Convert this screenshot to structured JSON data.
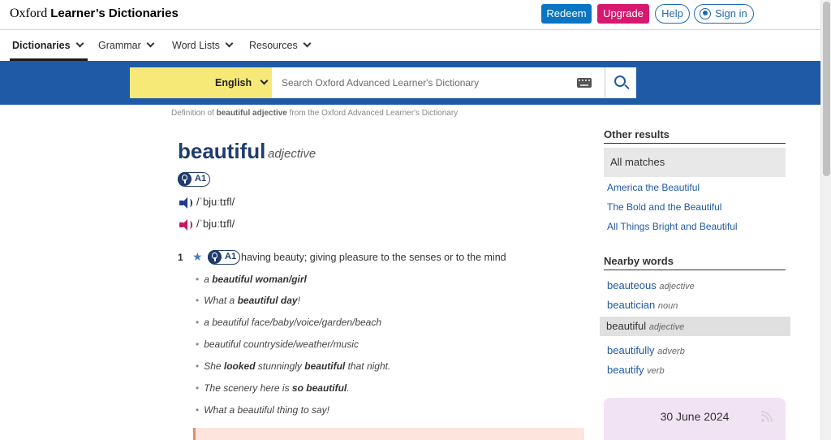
{
  "header": {
    "logo_part1": "Oxford ",
    "logo_part2": "Learner’s Dictionaries",
    "redeem": "Redeem",
    "upgrade": "Upgrade",
    "help": "Help",
    "sign_in": "Sign in"
  },
  "nav": {
    "items": [
      {
        "label": "Dictionaries"
      },
      {
        "label": "Grammar"
      },
      {
        "label": "Word Lists"
      },
      {
        "label": "Resources"
      }
    ]
  },
  "search": {
    "language": "English",
    "placeholder": "Search Oxford Advanced Learner's Dictionary"
  },
  "definition_line": {
    "prefix": "Definition of ",
    "term": "beautiful adjective",
    "suffix": " from the Oxford Advanced Learner's Dictionary"
  },
  "entry": {
    "headword": "beautiful",
    "pos": "adjective",
    "level": "A1",
    "pron_br": "/ˈbjuːtɪfl/",
    "pron_us": "/ˈbjuːtɪfl/",
    "sense": {
      "number": "1",
      "level": "A1",
      "definition": "having beauty; giving pleasure to the senses or to the mind",
      "examples": [
        {
          "pre": "a ",
          "bold": "beautiful woman/girl",
          "post": ""
        },
        {
          "pre": "What a ",
          "bold": "beautiful day",
          "post": "!"
        },
        {
          "pre": "a beautiful face/baby/voice/garden/beach",
          "bold": "",
          "post": ""
        },
        {
          "pre": "beautiful countryside/weather/music",
          "bold": "",
          "post": ""
        },
        {
          "pre": "She ",
          "bold": "looked",
          "post": " stunningly ",
          "bold2": "beautiful",
          "post2": " that night."
        },
        {
          "pre": "The scenery here is ",
          "bold": "so beautiful",
          "post": "."
        },
        {
          "pre": "What a beautiful thing to say!",
          "bold": "",
          "post": ""
        }
      ]
    }
  },
  "sidebar": {
    "other_results_title": "Other results",
    "all_matches": "All matches",
    "other_results": [
      "America the Beautiful",
      "The Bold and the Beautiful",
      "All Things Bright and Beautiful"
    ],
    "nearby_title": "Nearby words",
    "nearby": [
      {
        "word": "beauteous",
        "pos": "adjective"
      },
      {
        "word": "beautician",
        "pos": "noun"
      },
      {
        "word": "beautiful",
        "pos": "adjective"
      },
      {
        "word": "beautifully",
        "pos": "adverb"
      },
      {
        "word": "beautify",
        "pos": "verb"
      }
    ],
    "word_of_day_date": "30 June 2024"
  }
}
